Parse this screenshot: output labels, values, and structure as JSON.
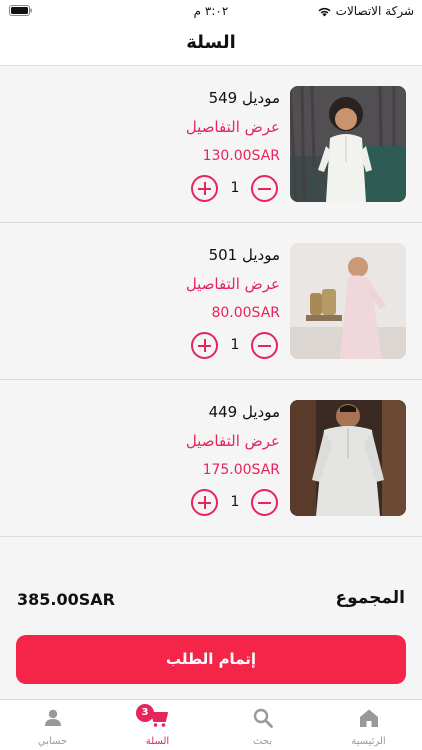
{
  "status_bar": {
    "carrier": "شركة الاتصالات",
    "time": "٣:٠٢ م"
  },
  "header": {
    "title": "السلة"
  },
  "colors": {
    "accent": "#e5255c",
    "button": "#f5254a"
  },
  "cart": {
    "items": [
      {
        "name": "موديل 549",
        "details_label": "عرض التفاصيل",
        "price": "130.00SAR",
        "quantity": "1"
      },
      {
        "name": "موديل 501",
        "details_label": "عرض التفاصيل",
        "price": "80.00SAR",
        "quantity": "1"
      },
      {
        "name": "موديل 449",
        "details_label": "عرض التفاصيل",
        "price": "175.00SAR",
        "quantity": "1"
      }
    ],
    "total_label": "المجموع",
    "total_value": "385.00SAR",
    "checkout_label": "إتمام الطلب"
  },
  "tab_bar": {
    "tabs": [
      {
        "label": "حسابي",
        "icon": "person-icon"
      },
      {
        "label": "السلة",
        "icon": "cart-icon",
        "badge": "3"
      },
      {
        "label": "بحث",
        "icon": "search-icon"
      },
      {
        "label": "الرئيسية",
        "icon": "home-icon"
      }
    ]
  }
}
